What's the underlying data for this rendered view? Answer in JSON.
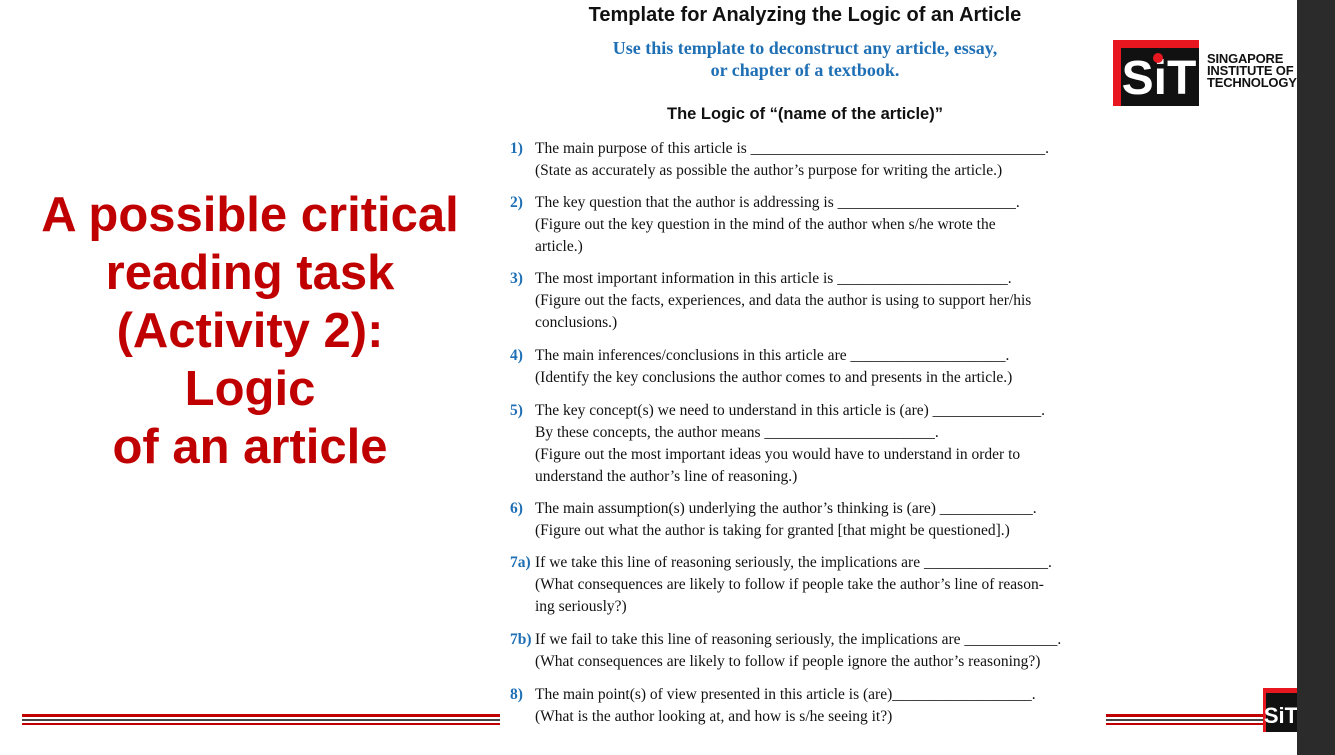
{
  "slide": {
    "left_title_lines": [
      "A possible critical",
      "reading task",
      "(Activity 2):",
      "Logic",
      "of an article"
    ],
    "template_title": "Template for Analyzing the Logic of an Article",
    "template_subtitle_lines": [
      "Use this template to deconstruct any article, essay,",
      "or chapter of a textbook."
    ],
    "logic_heading": "The Logic of “(name of the article)”",
    "logo": {
      "mark": "SiT",
      "text_lines": [
        "SINGAPORE",
        "INSTITUTE OF",
        "TECHNOLOGY"
      ]
    },
    "items": [
      {
        "num": "1)",
        "lines": [
          "The main purpose of this article is ______________________________________.",
          "(State as accurately as possible the author’s purpose for writing the article.)"
        ]
      },
      {
        "num": "2)",
        "lines": [
          "The key question that the author is addressing is _______________________.",
          "(Figure out the key question in the mind of the author when s/he wrote the",
          "article.)"
        ]
      },
      {
        "num": "3)",
        "lines": [
          "The most important information in this article is ______________________.",
          "(Figure out the facts, experiences, and data the author is using to support her/his",
          "conclusions.)"
        ]
      },
      {
        "num": "4)",
        "lines": [
          "The main inferences/conclusions in this article are ____________________.",
          "(Identify the key conclusions the author comes to and presents in the article.)"
        ]
      },
      {
        "num": "5)",
        "lines": [
          "The key concept(s) we need to understand in this article is (are) ______________.",
          "By these concepts, the author means ______________________.",
          "(Figure out the most important ideas you would have to understand in order to",
          "understand the author’s line of reasoning.)"
        ]
      },
      {
        "num": "6)",
        "lines": [
          "The main assumption(s) underlying the author’s thinking is (are) ____________.",
          "(Figure out what the author is taking for granted [that might be questioned].)"
        ]
      },
      {
        "num": "7a)",
        "lines": [
          "If we take this line of reasoning seriously, the implications are ________________.",
          "(What consequences are likely to follow if people take the author’s line of reason-",
          "ing seriously?)"
        ]
      },
      {
        "num": "7b)",
        "lines": [
          "If we fail to take this line of reasoning seriously, the implications are ____________.",
          "(What consequences are likely to follow if people ignore the author’s reasoning?)"
        ]
      },
      {
        "num": "8)",
        "lines": [
          "The main point(s) of view presented in this article is (are)__________________.",
          "(What is the author looking at, and how is s/he seeing it?)"
        ]
      }
    ]
  },
  "colors": {
    "title_red": "#c00000",
    "number_blue": "#1f6fb5",
    "logo_red": "#e8171f",
    "logo_black": "#111111"
  }
}
